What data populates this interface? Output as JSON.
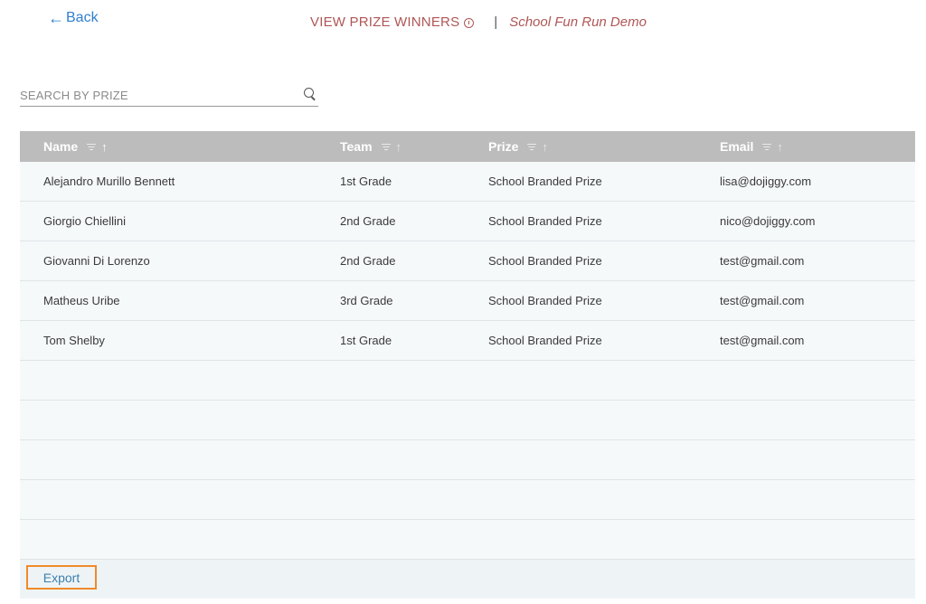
{
  "nav": {
    "back_label": "Back"
  },
  "header": {
    "title": "VIEW PRIZE WINNERS",
    "separator": "|",
    "subtitle": "School Fun Run Demo"
  },
  "search": {
    "placeholder": "SEARCH BY PRIZE",
    "value": ""
  },
  "table": {
    "columns": [
      {
        "label": "Name",
        "sort": "active"
      },
      {
        "label": "Team",
        "sort": "inactive"
      },
      {
        "label": "Prize",
        "sort": "inactive"
      },
      {
        "label": "Email",
        "sort": "inactive"
      }
    ],
    "rows": [
      [
        "Alejandro Murillo Bennett",
        "1st Grade",
        "School Branded Prize",
        "lisa@dojiggy.com"
      ],
      [
        "Giorgio Chiellini",
        "2nd Grade",
        "School Branded Prize",
        "nico@dojiggy.com"
      ],
      [
        "Giovanni Di Lorenzo",
        "2nd Grade",
        "School Branded Prize",
        "test@gmail.com"
      ],
      [
        "Matheus Uribe",
        "3rd Grade",
        "School Branded Prize",
        "test@gmail.com"
      ],
      [
        "Tom Shelby",
        "1st Grade",
        "School Branded Prize",
        "test@gmail.com"
      ]
    ],
    "empty_rows": 5
  },
  "footer": {
    "export_label": "Export"
  },
  "colors": {
    "accent_link": "#2f7fd0",
    "header_text": "#b05656",
    "table_header_bg": "#bcbcbc",
    "row_bg": "#f6f9fa",
    "export_border": "#f08a2a"
  },
  "icons": {
    "back": "left-arrow-icon",
    "info": "info-icon",
    "search": "search-icon",
    "filter": "filter-icon",
    "sort": "sort-up-arrow-icon"
  }
}
